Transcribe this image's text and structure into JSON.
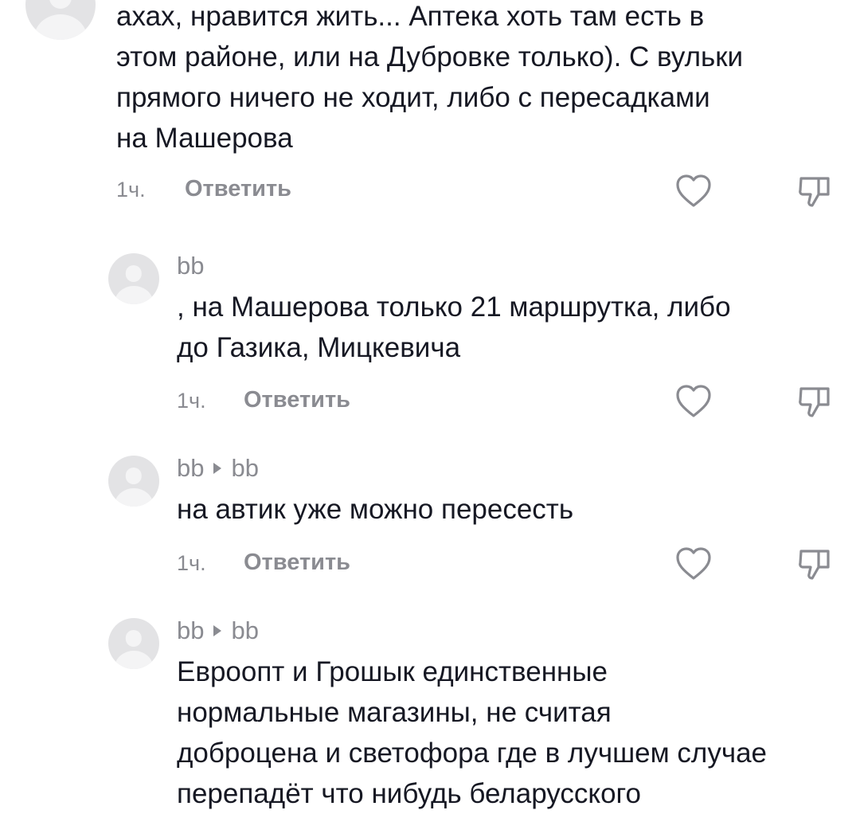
{
  "comments": [
    {
      "text": "ахах, нравится жить... Аптека хоть там есть в\nэтом районе, или на Дубровке только). С вульки\nпрямого ничего не ходит, либо с пересадками\nна Машерова",
      "time": "1ч.",
      "reply_label": "Ответить"
    },
    {
      "username": "bb",
      "text": ", на Машерова только 21 маршрутка, либо\nдо Газика, Мицкевича",
      "time": "1ч.",
      "reply_label": "Ответить"
    },
    {
      "username": "bb",
      "reply_to": "bb",
      "text": "на автик уже можно пересесть",
      "time": "1ч.",
      "reply_label": "Ответить"
    },
    {
      "username": "bb",
      "reply_to": "bb",
      "text": "Евроопт и Грошык единственные\nнормальные магазины, не считая\nдоброцена и светофора где в лучшем случае\nперепадёт что нибудь беларусского"
    }
  ],
  "icons": {
    "like": "heart-outline-icon",
    "dislike": "thumbs-down-outline-icon"
  },
  "colors": {
    "text": "#161823",
    "secondary": "#8a8b91",
    "avatar_bg": "#e3e3e5"
  }
}
